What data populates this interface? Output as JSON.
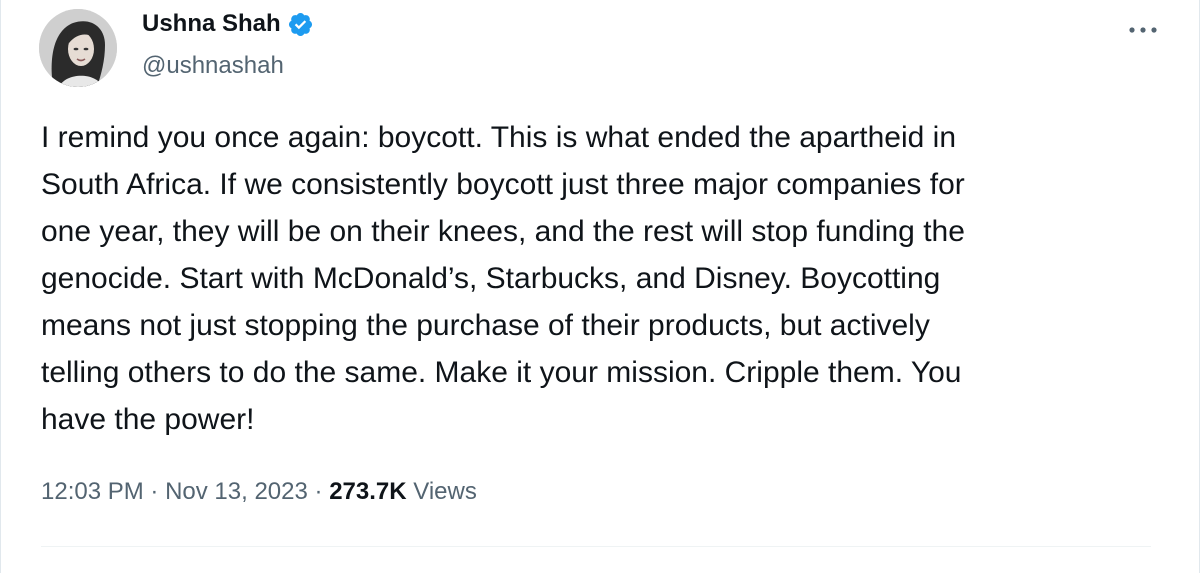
{
  "author": {
    "name": "Ushna Shah",
    "handle": "@ushnashah",
    "verified_color": "#1d9bf0",
    "avatar_icon": "profile-photo"
  },
  "tweet": {
    "text": "I remind you once again: boycott. This is what ended the apartheid in\nSouth Africa. If we consistently boycott just three major companies for\none year, they will be on their knees, and the rest will stop funding the\ngenocide. Start with McDonald’s, Starbucks, and Disney. Boycotting\nmeans not just stopping the purchase of their products, but actively\ntelling others to do the same. Make it your mission. Cripple them. You\nhave the power!"
  },
  "meta": {
    "time": "12:03 PM",
    "separator": "·",
    "date": "Nov 13, 2023",
    "views_count": "273.7K",
    "views_label": "Views"
  },
  "actions": {
    "more_icon": "more-horizontal-icon"
  },
  "colors": {
    "text_primary": "#0f1419",
    "text_secondary": "#536471",
    "accent": "#1d9bf0",
    "divider": "#eff3f4"
  }
}
